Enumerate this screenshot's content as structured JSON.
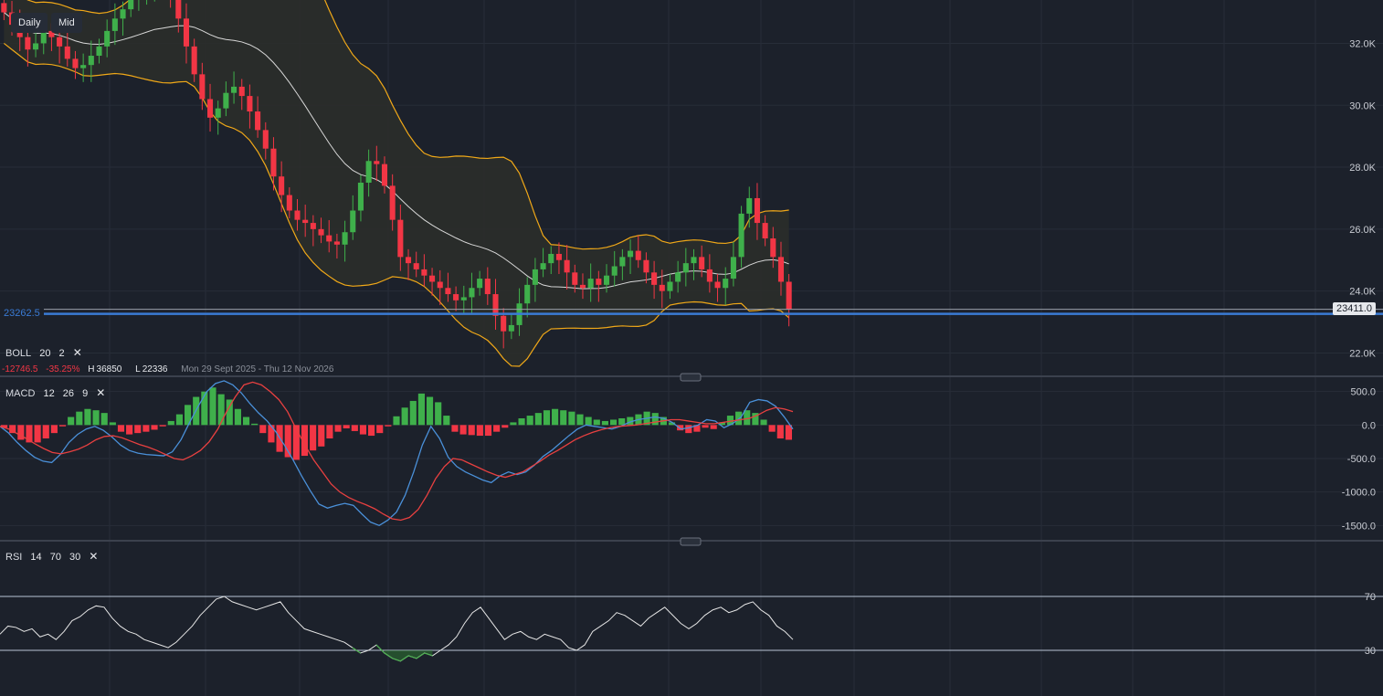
{
  "toolbar": {
    "interval_label": "Daily",
    "price_source_label": "Mid"
  },
  "price_panel": {
    "y_ticks": [
      "32.0K",
      "30.0K",
      "28.0K",
      "26.0K",
      "24.0K",
      "22.0K"
    ],
    "last_price_tag": "23411.0",
    "support_level_tag": "23262.5",
    "support_level": 23262.5,
    "last_price": 23411.0
  },
  "boll_legend": {
    "name": "BOLL",
    "p1": "20",
    "p2": "2"
  },
  "range_stats": {
    "change": "-12746.5",
    "change_pct": "-35.25%",
    "high_label": "H",
    "high": "36850",
    "low_label": "L",
    "low": "22336",
    "date_range": "Mon 29 Sept 2025 - Thu 12 Nov 2026"
  },
  "macd_legend": {
    "name": "MACD",
    "p1": "12",
    "p2": "26",
    "p3": "9"
  },
  "macd_panel": {
    "y_ticks": [
      "500.0",
      "0.0",
      "-500.0",
      "-1000.0",
      "-1500.0"
    ]
  },
  "rsi_legend": {
    "name": "RSI",
    "p1": "14",
    "p2": "70",
    "p3": "30"
  },
  "rsi_panel": {
    "y_ticks": [
      "70",
      "30"
    ]
  },
  "colors": {
    "background": "#1c212b",
    "up": "#26a69a",
    "up_candle": "#3fb04b",
    "down": "#f23645",
    "boll_band": "#f0a818",
    "boll_mid": "#d8d8d8",
    "macd_line": "#4a90d9",
    "signal_line": "#e84040",
    "support_line": "#3a7bd5",
    "rsi_line": "#e6e6e6"
  },
  "chart_data": [
    {
      "type": "candlestick",
      "title": "",
      "ylim": [
        21600,
        33400
      ],
      "close": [
        33000,
        32600,
        32200,
        31800,
        32000,
        32400,
        32200,
        31900,
        31500,
        31200,
        31300,
        31600,
        31900,
        32400,
        32800,
        33100,
        33400,
        33700,
        33900,
        34100,
        33800,
        33500,
        32800,
        31900,
        31000,
        30200,
        29600,
        29900,
        30400,
        30600,
        30300,
        29800,
        29200,
        28600,
        27700,
        27100,
        26600,
        26300,
        26200,
        26000,
        25800,
        25600,
        25500,
        25900,
        26600,
        27500,
        28200,
        28100,
        27400,
        26300,
        25100,
        24900,
        24700,
        24500,
        24300,
        24100,
        23900,
        23700,
        23800,
        24100,
        24400,
        23900,
        23200,
        22700,
        22900,
        23600,
        24200,
        24700,
        24900,
        25200,
        25000,
        24600,
        24200,
        24100,
        24400,
        24200,
        24500,
        24800,
        25100,
        25300,
        25000,
        24600,
        24200,
        24000,
        24300,
        24600,
        24900,
        25100,
        24700,
        24300,
        24100,
        24400,
        25100,
        26500,
        27000,
        26200,
        25700,
        25100,
        24300,
        23411
      ],
      "bollinger": {
        "period": 20,
        "stddev": 2
      }
    },
    {
      "type": "line",
      "title": "",
      "ylim": [
        -1700,
        700
      ],
      "series": [
        {
          "values": [
            -20,
            -120,
            -260,
            -380,
            -480,
            -540,
            -560,
            -440,
            -260,
            -140,
            -60,
            -20,
            -80,
            -180,
            -300,
            -380,
            -420,
            -440,
            -450,
            -460,
            -400,
            -220,
            40,
            280,
            500,
            620,
            660,
            600,
            480,
            320,
            180,
            60,
            -100,
            -300,
            -520,
            -760,
            -980,
            -1180,
            -1240,
            -1200,
            -1170,
            -1200,
            -1330,
            -1450,
            -1500,
            -1420,
            -1300,
            -1050,
            -700,
            -300,
            -20,
            -200,
            -480,
            -620,
            -700,
            -760,
            -820,
            -860,
            -760,
            -700,
            -740,
            -700,
            -600,
            -470,
            -380,
            -270,
            -160,
            -60,
            0,
            -20,
            -40,
            -60,
            -20,
            40,
            80,
            100,
            120,
            100,
            40,
            -60,
            -40,
            0,
            80,
            60,
            -40,
            20,
            120,
            340,
            380,
            360,
            280,
            120,
            -60
          ]
        },
        {
          "values": [
            -20,
            -60,
            -130,
            -200,
            -280,
            -350,
            -410,
            -430,
            -400,
            -360,
            -300,
            -220,
            -170,
            -160,
            -190,
            -240,
            -290,
            -330,
            -380,
            -440,
            -500,
            -520,
            -460,
            -380,
            -250,
            -60,
            200,
            420,
            600,
            640,
            600,
            500,
            380,
            200,
            -60,
            -300,
            -520,
            -700,
            -880,
            -1000,
            -1080,
            -1140,
            -1190,
            -1250,
            -1330,
            -1400,
            -1420,
            -1380,
            -1260,
            -1050,
            -800,
            -620,
            -500,
            -520,
            -580,
            -640,
            -700,
            -750,
            -780,
            -740,
            -700,
            -620,
            -540,
            -450,
            -380,
            -300,
            -220,
            -160,
            -110,
            -70,
            -40,
            -20,
            -10,
            0,
            20,
            40,
            60,
            80,
            80,
            60,
            40,
            20,
            20,
            40,
            60,
            80,
            100,
            150,
            220,
            260,
            240,
            200
          ]
        }
      ],
      "histogram": [
        -40,
        -120,
        -220,
        -260,
        -260,
        -200,
        -120,
        -20,
        120,
        200,
        240,
        220,
        180,
        40,
        -100,
        -140,
        -120,
        -100,
        -70,
        -20,
        60,
        160,
        300,
        420,
        500,
        560,
        460,
        380,
        240,
        120,
        20,
        -120,
        -260,
        -400,
        -480,
        -520,
        -460,
        -380,
        -320,
        -200,
        -100,
        -50,
        -90,
        -140,
        -160,
        -120,
        -20,
        130,
        260,
        360,
        470,
        420,
        340,
        140,
        -100,
        -140,
        -150,
        -160,
        -160,
        -100,
        -40,
        40,
        100,
        140,
        180,
        220,
        240,
        220,
        200,
        160,
        120,
        80,
        60,
        80,
        100,
        120,
        160,
        200,
        180,
        120,
        40,
        -80,
        -120,
        -100,
        -40,
        -60,
        40,
        140,
        200,
        220,
        180,
        80,
        -100,
        -200,
        -220
      ]
    },
    {
      "type": "line",
      "title": "",
      "ylim": [
        0,
        100
      ],
      "series": [
        {
          "values": [
            42,
            48,
            47,
            44,
            46,
            40,
            42,
            38,
            44,
            52,
            55,
            60,
            63,
            62,
            54,
            48,
            44,
            42,
            38,
            36,
            34,
            32,
            36,
            42,
            48,
            56,
            62,
            68,
            70,
            66,
            64,
            62,
            60,
            62,
            64,
            66,
            58,
            52,
            46,
            44,
            42,
            40,
            38,
            36,
            32,
            28,
            30,
            34,
            28,
            24,
            22,
            26,
            24,
            28,
            26,
            30,
            34,
            40,
            50,
            58,
            62,
            54,
            46,
            38,
            42,
            44,
            40,
            38,
            42,
            40,
            38,
            32,
            30,
            34,
            44,
            48,
            52,
            58,
            56,
            52,
            48,
            54,
            58,
            62,
            56,
            50,
            46,
            50,
            56,
            60,
            62,
            58,
            60,
            64,
            66,
            60,
            56,
            48,
            44,
            38
          ]
        }
      ]
    }
  ]
}
